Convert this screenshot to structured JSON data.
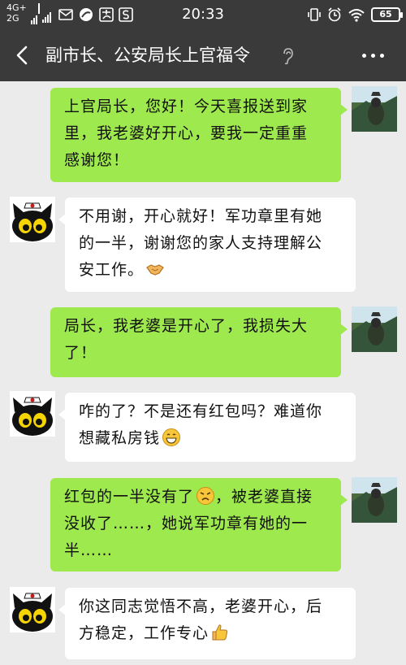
{
  "status": {
    "net_top": "4G+",
    "net_bottom": "2G",
    "time": "20:33",
    "battery": "65",
    "colors": {
      "bar": "#3a3a3a"
    }
  },
  "header": {
    "title": "副市长、公安局长上官福令",
    "back_icon": "back-arrow-icon",
    "ear_icon": "earpiece-mode-icon",
    "more_icon": "more-dots-icon"
  },
  "colors": {
    "sent_bubble": "#9ee94d",
    "received_bubble": "#ffffff",
    "background": "#ebebeb"
  },
  "messages": [
    {
      "from": "me",
      "lines": [
        "上官局长，您好！今天喜报送到家",
        "里，我老婆好开心，要我一定重重",
        "感谢您！"
      ]
    },
    {
      "from": "other",
      "lines": [
        "不用谢，开心就好！军功章里有她",
        "的一半，谢谢您的家人支持理解公",
        "安工作。"
      ],
      "emoji": "handshake-emoji"
    },
    {
      "from": "me",
      "lines": [
        "局长，我老婆是开心了，我损失大",
        "了！"
      ]
    },
    {
      "from": "other",
      "lines": [
        "咋的了？不是还有红包吗？难道你",
        "想藏私房钱"
      ],
      "emoji": "grin-emoji"
    },
    {
      "from": "me",
      "lines": [
        "红包的一半没有了",
        "，被老婆直接",
        "没收了……，她说军功章有她的一",
        "半……"
      ],
      "emoji": "angry-emoji"
    },
    {
      "from": "other",
      "lines": [
        "你这同志觉悟不高，老婆开心，后",
        "方稳定，工作专心"
      ],
      "emoji": "thumbs-up-emoji"
    }
  ]
}
